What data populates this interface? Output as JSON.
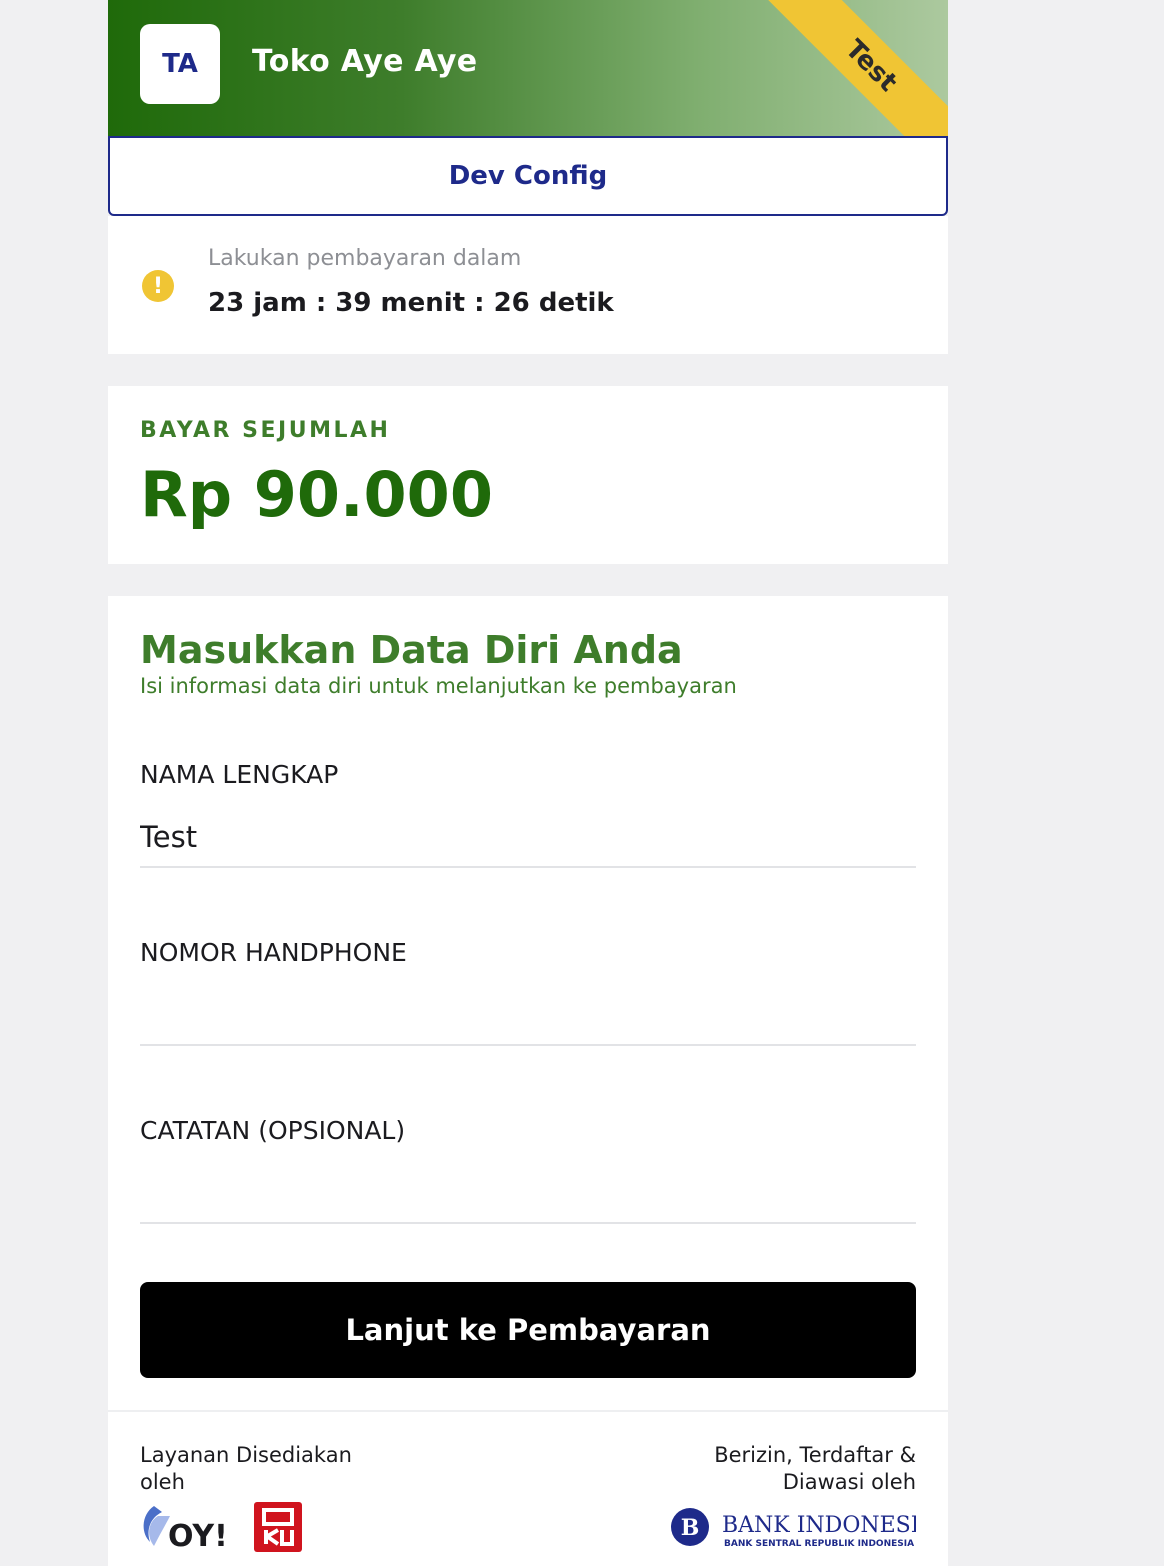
{
  "header": {
    "avatar_initials": "TA",
    "merchant_name": "Toko Aye Aye",
    "ribbon_label": "Test"
  },
  "dev_config": {
    "label": "Dev Config"
  },
  "timer": {
    "label": "Lakukan pembayaran dalam",
    "value": "23 jam : 39 menit : 26 detik",
    "icon": "warning-icon"
  },
  "amount": {
    "label": "BAYAR SEJUMLAH",
    "value": "Rp 90.000"
  },
  "form": {
    "title": "Masukkan Data Diri Anda",
    "subtitle": "Isi informasi data diri untuk melanjutkan ke pembayaran",
    "fields": [
      {
        "label": "NAMA LENGKAP",
        "value": "Test"
      },
      {
        "label": "NOMOR HANDPHONE",
        "value": ""
      },
      {
        "label": "CATATAN (OPSIONAL)",
        "value": ""
      }
    ],
    "submit_label": "Lanjut ke Pembayaran"
  },
  "footer": {
    "left_text": "Layanan Disediakan oleh",
    "right_text": "Berizin, Terdaftar & Diawasi oleh",
    "logos": {
      "oy": "OY!",
      "doku": "DOKU",
      "bi_name": "BANK INDONESIA",
      "bi_sub": "BANK SENTRAL REPUBLIK INDONESIA"
    }
  },
  "colors": {
    "brand_green": "#1f6a0a",
    "accent_green": "#3e7d2b",
    "navy": "#1e2a8a",
    "ribbon_yellow": "#f0c534",
    "button_black": "#000000"
  }
}
